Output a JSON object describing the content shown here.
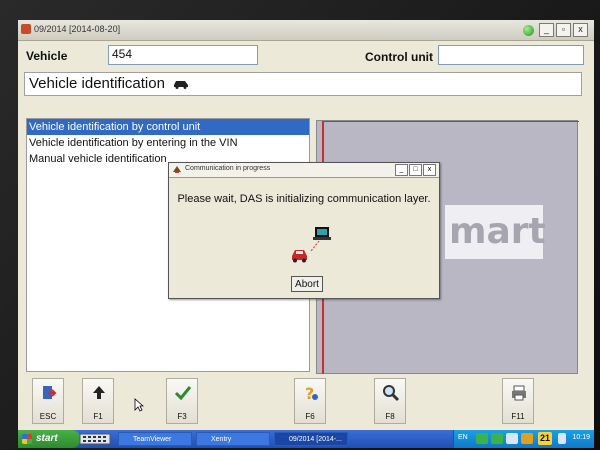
{
  "window": {
    "title": "09/2014 [2014-08-20]",
    "buttons": [
      "_",
      "▫",
      "x"
    ]
  },
  "vehicle": {
    "label": "Vehicle",
    "value": "454"
  },
  "control_unit": {
    "label": "Control unit",
    "value": ""
  },
  "section": {
    "title": "Vehicle identification"
  },
  "options": [
    {
      "label": "Vehicle identification by control unit",
      "selected": true
    },
    {
      "label": "Vehicle identification by entering in the VIN",
      "selected": false
    },
    {
      "label": "Manual vehicle identification",
      "selected": false
    }
  ],
  "brand_logo": "mart",
  "dialog": {
    "title": "Communication in progress",
    "message": "Please wait, DAS is initializing communication layer.",
    "abort_label": "Abort",
    "title_buttons": [
      "_",
      "□",
      "x"
    ]
  },
  "function_keys": [
    {
      "label": "ESC",
      "icon": "exit-door-icon"
    },
    {
      "label": "F1",
      "icon": "arrow-up-icon"
    },
    {
      "label": "F3",
      "icon": "checkmark-icon"
    },
    {
      "label": "F6",
      "icon": "question-help-icon"
    },
    {
      "label": "F8",
      "icon": "magnifier-icon"
    },
    {
      "label": "F11",
      "icon": "printer-icon"
    }
  ],
  "taskbar": {
    "start_label": "start",
    "items": [
      "TeamViewer",
      "Xentry",
      "09/2014 [2014-..."
    ],
    "tray_label": "EN",
    "tray_number": "21",
    "clock": "10:19"
  },
  "colors": {
    "selection": "#316ac5",
    "window_bg": "#ece9d8",
    "panel_bg": "#b9b7c4",
    "accent_red": "#c83030",
    "taskbar_blue": "#1f4fb5"
  }
}
